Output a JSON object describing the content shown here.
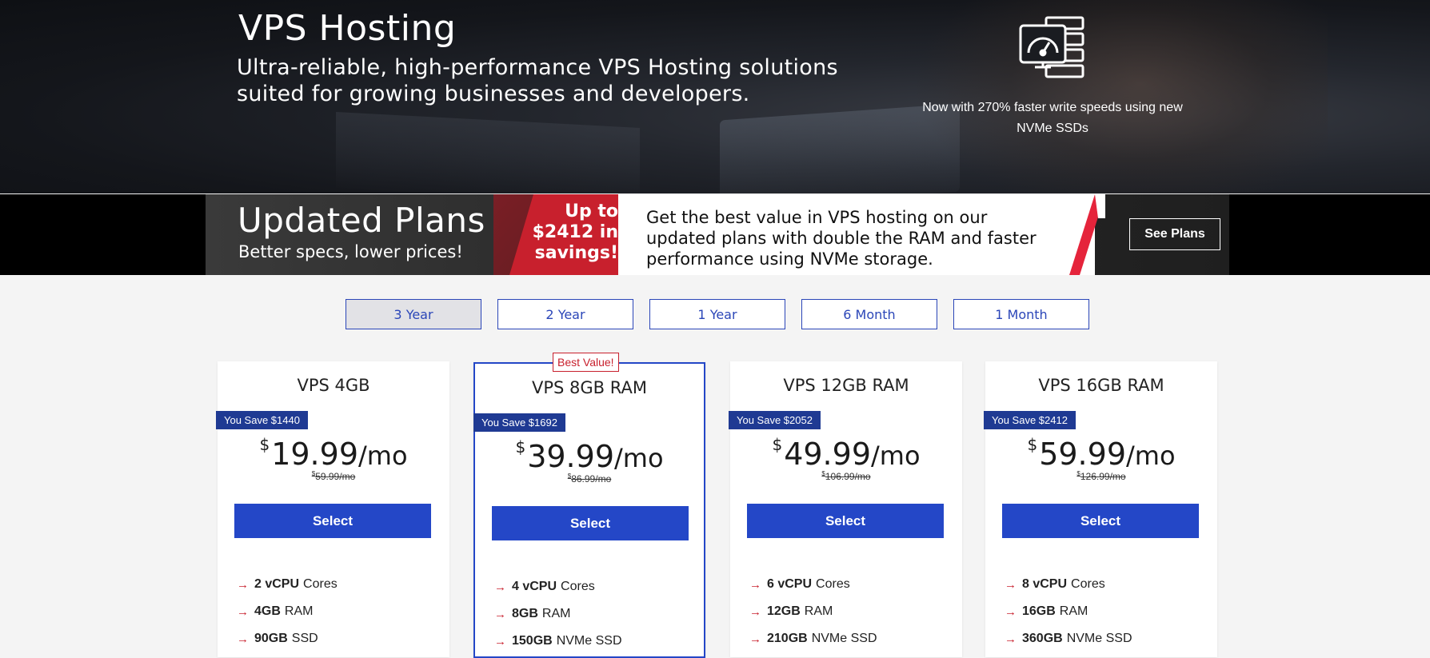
{
  "hero": {
    "title": "VPS Hosting",
    "subtitle": "Ultra-reliable, high-performance VPS Hosting solutions suited for growing businesses and developers.",
    "note": "Now with 270% faster write speeds using new NVMe SSDs",
    "icon": "server-speedometer-icon"
  },
  "banner": {
    "title": "Updated Plans",
    "subtitle": "Better specs, lower prices!",
    "savings": "Up to $2412 in savings!",
    "description": "Get the best value in VPS hosting on our updated plans with double the RAM and faster performance using NVMe storage.",
    "cta": "See Plans",
    "accent": "#c8202d"
  },
  "terms": [
    {
      "label": "3 Year",
      "active": true
    },
    {
      "label": "2 Year",
      "active": false
    },
    {
      "label": "1 Year",
      "active": false
    },
    {
      "label": "6 Month",
      "active": false
    },
    {
      "label": "1 Month",
      "active": false
    }
  ],
  "featured_badge": "Best Value!",
  "select_label": "Select",
  "currency": "$",
  "per_month": "/mo",
  "plans": [
    {
      "name": "VPS 4GB",
      "save": "You Save $1440",
      "price": "19.99",
      "old": "59.99/mo",
      "features": [
        {
          "bold": "2 vCPU",
          "text": "Cores"
        },
        {
          "bold": "4GB",
          "text": "RAM"
        },
        {
          "bold": "90GB",
          "text": "SSD"
        }
      ]
    },
    {
      "name": "VPS 8GB RAM",
      "save": "You Save $1692",
      "price": "39.99",
      "old": "86.99/mo",
      "features": [
        {
          "bold": "4 vCPU",
          "text": "Cores"
        },
        {
          "bold": "8GB",
          "text": "RAM"
        },
        {
          "bold": "150GB",
          "text": "NVMe SSD"
        }
      ]
    },
    {
      "name": "VPS 12GB RAM",
      "save": "You Save $2052",
      "price": "49.99",
      "old": "106.99/mo",
      "features": [
        {
          "bold": "6 vCPU",
          "text": "Cores"
        },
        {
          "bold": "12GB",
          "text": "RAM"
        },
        {
          "bold": "210GB",
          "text": "NVMe SSD"
        }
      ]
    },
    {
      "name": "VPS 16GB RAM",
      "save": "You Save $2412",
      "price": "59.99",
      "old": "126.99/mo",
      "features": [
        {
          "bold": "8 vCPU",
          "text": "Cores"
        },
        {
          "bold": "16GB",
          "text": "RAM"
        },
        {
          "bold": "360GB",
          "text": "NVMe SSD"
        }
      ]
    }
  ],
  "colors": {
    "primary": "#2447c7",
    "save_tag": "#1f3a93",
    "accent_red": "#c8202d",
    "page_bg": "#f4f4f4"
  }
}
